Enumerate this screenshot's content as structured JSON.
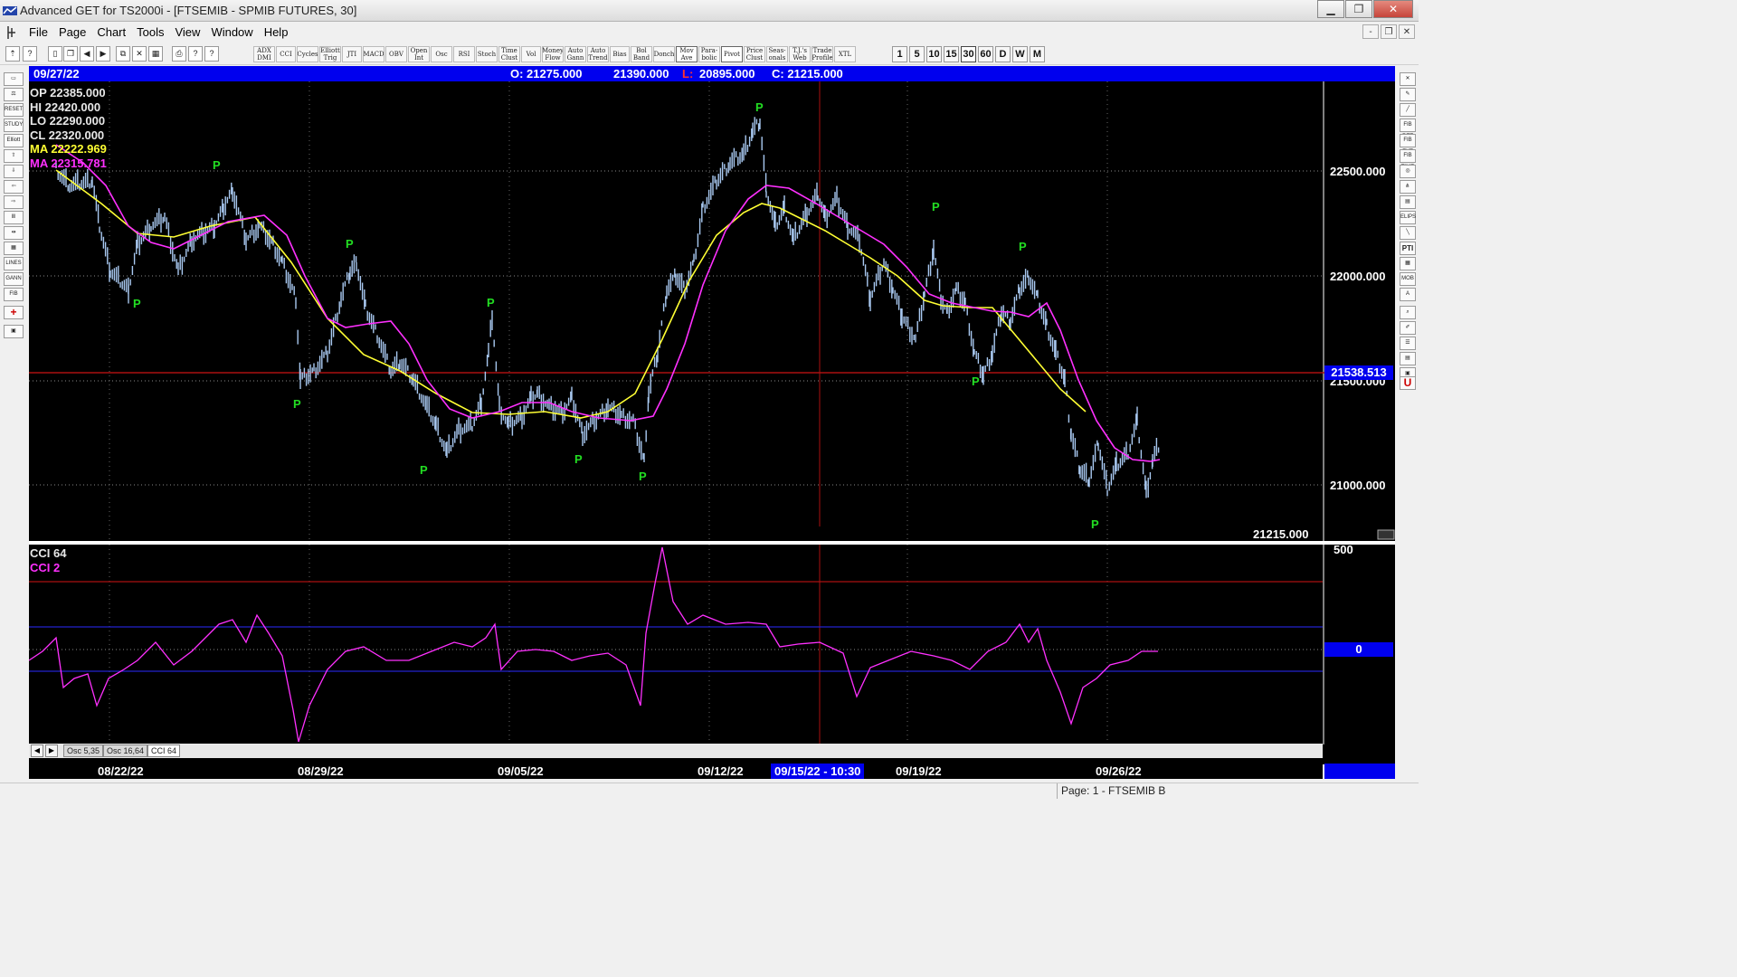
{
  "window": {
    "title": "Advanced GET for TS2000i - [FTSEMIB - SPMIB FUTURES, 30]",
    "controls": {
      "minimize": "▁",
      "maximize": "❐",
      "close": "✕"
    }
  },
  "menu": {
    "items": [
      "File",
      "Page",
      "Chart",
      "Tools",
      "View",
      "Window",
      "Help"
    ],
    "mdi_controls": {
      "minimize": "-",
      "restore": "❐",
      "close": "✕"
    }
  },
  "toolbar": {
    "study_buttons": [
      "ADX DMI",
      "CCI",
      "Cycles",
      "Elliott Trig",
      "JTI",
      "MACD",
      "OBV",
      "Open Int",
      "Osc",
      "RSI",
      "Stoch",
      "Time Clust",
      "Vol",
      "Money Flow",
      "Auto Gann",
      "Auto Trend",
      "Bias",
      "Bol Band",
      "Donch",
      "Mov Ave",
      "Para-bolic",
      "Pivot",
      "Price Clust",
      "Seas-onals",
      "T.J.'s Web",
      "Trade Profile",
      "XTL"
    ],
    "timeframes": [
      "1",
      "5",
      "10",
      "15",
      "30",
      "60",
      "D",
      "W",
      "M"
    ],
    "active_timeframe": "30"
  },
  "infobar": {
    "date": "09/27/22",
    "open": "O: 21275.000",
    "high": "21390.000",
    "low_label": "L:",
    "low": "20895.000",
    "close": "C: 21215.000"
  },
  "ohlc": {
    "op": "OP  22385.000",
    "hi": "HI   22420.000",
    "lo": "LO  22290.000",
    "cl": "CL  22320.000",
    "ma1": "MA  22222.969",
    "ma2": "MA  22315.781"
  },
  "price_axis": {
    "labels": [
      "22500.000",
      "22000.000",
      "21500.000",
      "21000.000"
    ],
    "cursor_price": "21538.513",
    "last_price": "21215.000"
  },
  "pivot_marker": "P",
  "cci": {
    "label1": "CCI 64",
    "label2": "CCI  2",
    "axis_top": "500",
    "zero_tag": "0"
  },
  "tabs": [
    "Osc 5,35",
    "Osc 16,64",
    "CCI 64"
  ],
  "active_tab": "CCI 64",
  "dates": {
    "labels": [
      "08/22/22",
      "08/29/22",
      "09/05/22",
      "09/12/22",
      "09/19/22",
      "09/26/22"
    ],
    "cursor": "09/15/22 - 10:30"
  },
  "status": "Page: 1 - FTSEMIB B",
  "colors": {
    "price_bars": "#a8c8f0",
    "ma_fast": "#ffff33",
    "ma_slow": "#ff30ff",
    "pivot": "#22dd22",
    "cursor_line": "#aa1111",
    "highlight_blue": "#0000ee"
  }
}
